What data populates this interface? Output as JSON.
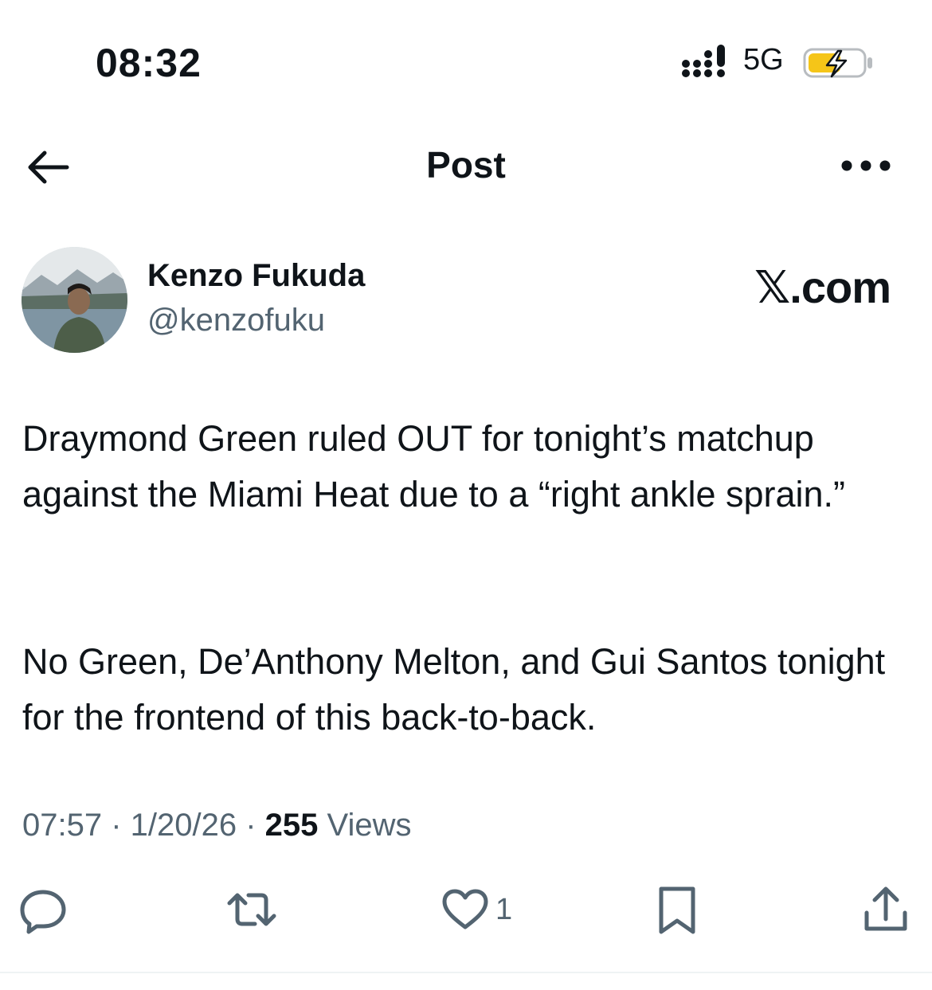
{
  "status_bar": {
    "time": "08:32",
    "network": "5G",
    "battery_color": "#f5c518"
  },
  "nav": {
    "title": "Post",
    "back_icon": "arrow-left-icon",
    "more_icon": "ellipsis-icon"
  },
  "post": {
    "author": {
      "name": "Kenzo Fukuda",
      "handle": "@kenzofuku"
    },
    "source_brand": "𝕏.com",
    "paragraphs": [
      "Draymond Green ruled OUT for tonight’s matchup against the Miami Heat due to a “right ankle sprain.”",
      "No Green, De’Anthony Melton, and Gui Santos tonight for the frontend of this back-to-back."
    ],
    "meta": {
      "time": "07:57",
      "sep1": " · ",
      "date": "1/20/26",
      "sep2": " · ",
      "views_count": "255",
      "views_label": " Views"
    },
    "actions": {
      "reply_icon": "reply-icon",
      "repost_icon": "repost-icon",
      "like_icon": "heart-icon",
      "like_count": "1",
      "bookmark_icon": "bookmark-icon",
      "share_icon": "share-icon"
    }
  },
  "colors": {
    "text_primary": "#0f1419",
    "text_secondary": "#536471"
  }
}
